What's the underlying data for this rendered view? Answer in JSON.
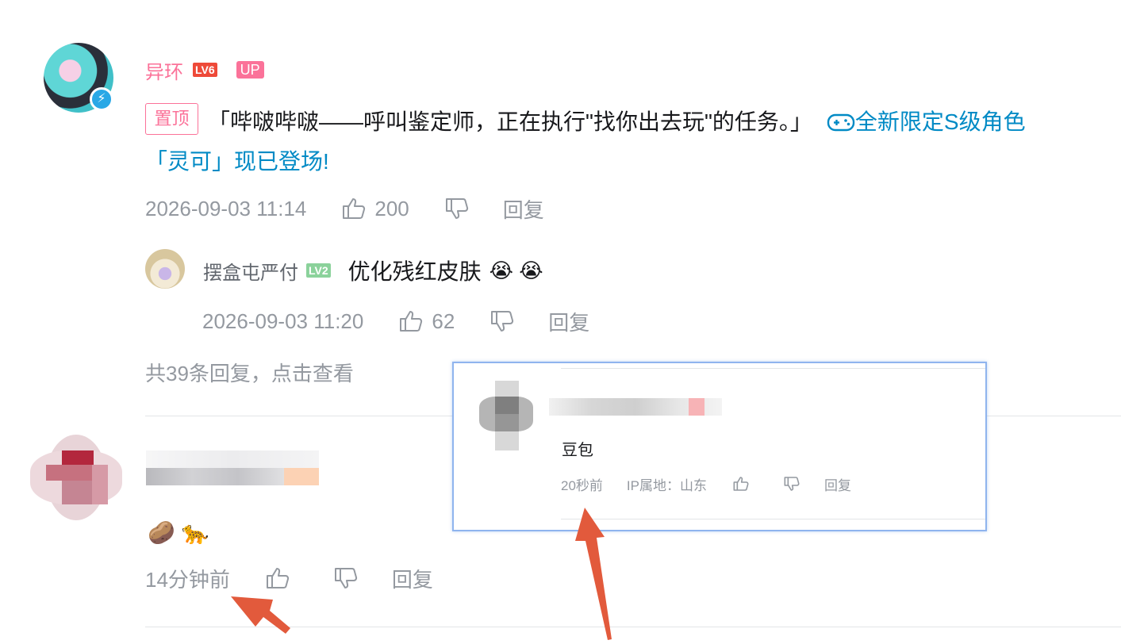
{
  "pinned_comment": {
    "username": "异环",
    "level": "LV6",
    "up_tag": "UP",
    "pin_label": "置顶",
    "text_line1": "「哔啵哔啵——呼叫鉴定师，正在执行\"找你出去玩\"的任务。」",
    "link_text_line1": "全新限定S级角色",
    "link_text_line2": "「灵可」现已登场!",
    "timestamp": "2026-09-03 11:14",
    "like_count": "200",
    "reply_label": "回复"
  },
  "sub_reply": {
    "username": "摆盒屯严付",
    "level": "LV2",
    "text": "优化残红皮肤",
    "emojis": "😭 😭",
    "timestamp": "2026-09-03 11:20",
    "like_count": "62",
    "reply_label": "回复"
  },
  "view_replies_label": "共39条回复，点击查看",
  "second_comment": {
    "emojis": "🥔 🐆",
    "time_ago": "14分钟前",
    "reply_label": "回复"
  },
  "popup_comment": {
    "text": "豆包",
    "time_ago": "20秒前",
    "ip_location": "IP属地：山东",
    "reply_label": "回复"
  },
  "colors": {
    "brand_pink": "#fb7299",
    "link_blue": "#008ac5",
    "meta_gray": "#9499a0",
    "arrow_red": "#e25a3c"
  },
  "icons": [
    "verified-bolt-icon",
    "gamepad-icon",
    "thumbs-up-icon",
    "thumbs-down-icon",
    "annotation-arrow-icon"
  ]
}
